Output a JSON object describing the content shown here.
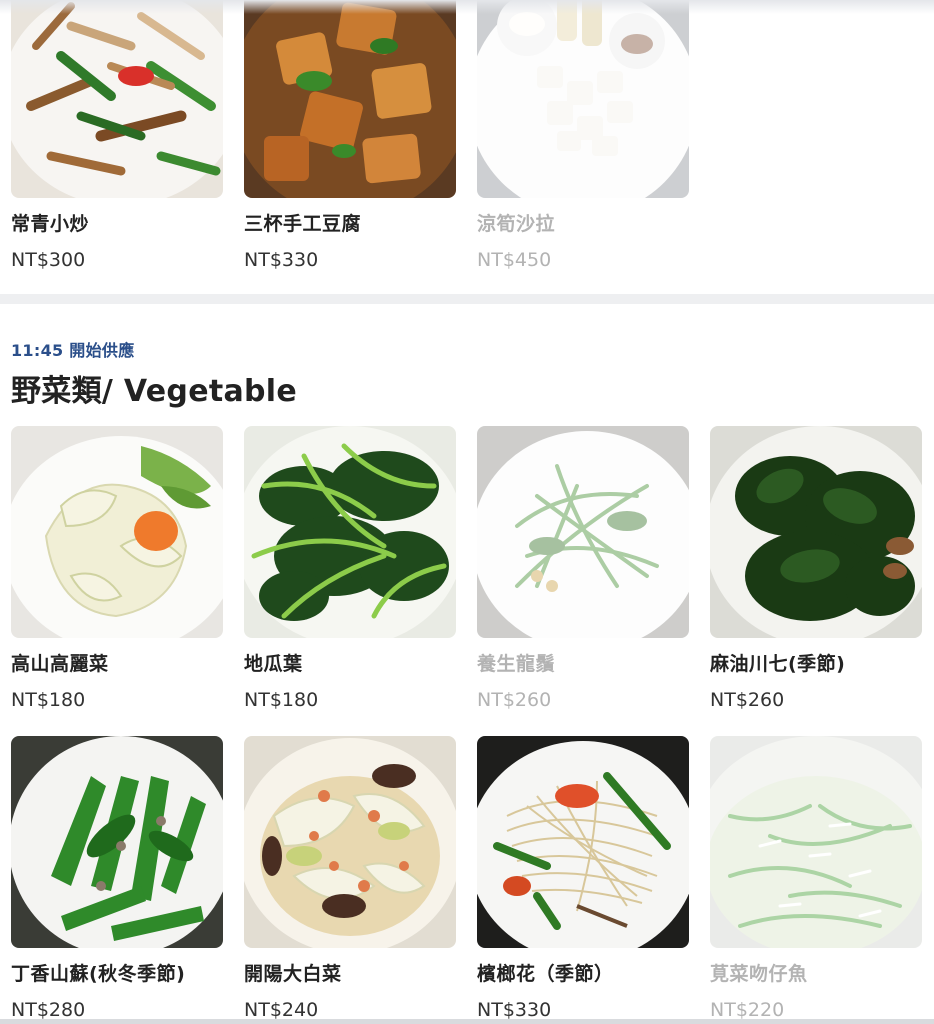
{
  "top_items": [
    {
      "name": "常青小炒",
      "price": "NT$300",
      "sold_out": false,
      "image": "stir-fry-photo"
    },
    {
      "name": "三杯手工豆腐",
      "price": "NT$330",
      "sold_out": false,
      "image": "tofu-photo"
    },
    {
      "name": "涼筍沙拉",
      "price": "NT$450",
      "sold_out": true,
      "image": "bamboo-salad-photo"
    }
  ],
  "section": {
    "serve_time": "11:45 開始供應",
    "title": "野菜類/ Vegetable",
    "items": [
      {
        "name": "高山高麗菜",
        "price": "NT$180",
        "sold_out": false,
        "image": "cabbage-photo"
      },
      {
        "name": "地瓜葉",
        "price": "NT$180",
        "sold_out": false,
        "image": "sweet-potato-leaf-photo"
      },
      {
        "name": "養生龍鬚",
        "price": "NT$260",
        "sold_out": true,
        "image": "chayote-shoot-photo"
      },
      {
        "name": "麻油川七(季節)",
        "price": "NT$260",
        "sold_out": false,
        "image": "madeira-vine-photo"
      },
      {
        "name": "丁香山蘇(秋冬季節)",
        "price": "NT$280",
        "sold_out": false,
        "image": "bird-nest-fern-photo"
      },
      {
        "name": "開陽大白菜",
        "price": "NT$240",
        "sold_out": false,
        "image": "napa-cabbage-photo"
      },
      {
        "name": "檳榔花（季節）",
        "price": "NT$330",
        "sold_out": false,
        "image": "betel-flower-photo"
      },
      {
        "name": "莧菜吻仔魚",
        "price": "NT$220",
        "sold_out": true,
        "image": "amaranth-fish-photo"
      }
    ]
  },
  "colors": {
    "accent": "#2b4f8a",
    "sold_out_text": "#b3b3b3",
    "divider": "#eeeff1"
  }
}
